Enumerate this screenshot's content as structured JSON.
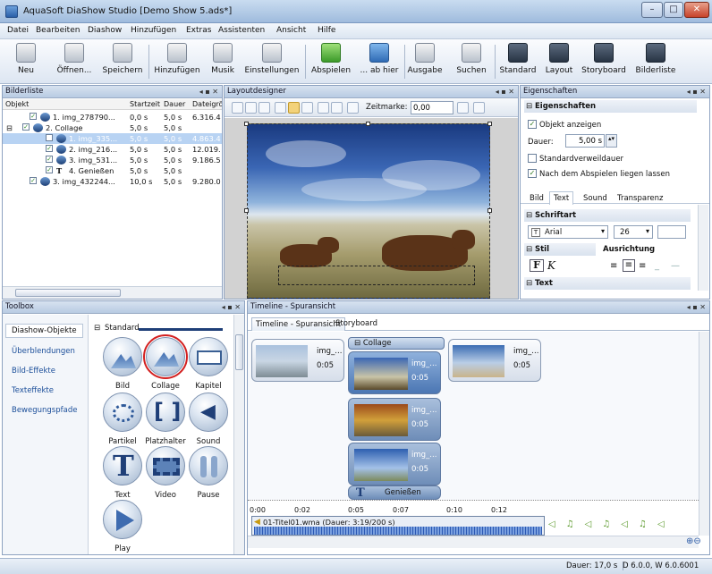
{
  "window": {
    "title": "AquaSoft DiaShow Studio [Demo Show 5.ads*]"
  },
  "menu": [
    "Datei",
    "Bearbeiten",
    "Diashow",
    "Hinzufügen",
    "Extras",
    "Assistenten",
    "Ansicht",
    "Hilfe"
  ],
  "toolbar": {
    "neu": "Neu",
    "oeffnen": "Öffnen...",
    "speichern": "Speichern",
    "hinzufuegen": "Hinzufügen",
    "musik": "Musik",
    "einstellungen": "Einstellungen",
    "abspielen": "Abspielen",
    "abhier": "... ab hier",
    "ausgabe": "Ausgabe",
    "suchen": "Suchen",
    "standard": "Standard",
    "layout": "Layout",
    "storyboard": "Storyboard",
    "bilderliste": "Bilderliste"
  },
  "bilderliste": {
    "title": "Bilderliste",
    "cols": {
      "objekt": "Objekt",
      "startzeit": "Startzeit",
      "dauer": "Dauer",
      "datei": "Dateigrö"
    },
    "rows": [
      {
        "name": "1. img_278790...",
        "start": "0,0 s",
        "dauer": "5,0 s",
        "size": "6.316.4"
      },
      {
        "name": "2. Collage",
        "start": "5,0 s",
        "dauer": "5,0 s",
        "size": ""
      },
      {
        "name": "1. img_335...",
        "start": "5,0 s",
        "dauer": "5,0 s",
        "size": "4.863.4"
      },
      {
        "name": "2. img_216...",
        "start": "5,0 s",
        "dauer": "5,0 s",
        "size": "12.019."
      },
      {
        "name": "3. img_531...",
        "start": "5,0 s",
        "dauer": "5,0 s",
        "size": "9.186.5"
      },
      {
        "name": "4. Genießen",
        "start": "5,0 s",
        "dauer": "5,0 s",
        "size": ""
      },
      {
        "name": "3. img_432244...",
        "start": "10,0 s",
        "dauer": "5,0 s",
        "size": "9.280.0"
      }
    ]
  },
  "layoutdesigner": {
    "title": "Layoutdesigner",
    "zeitmarke_label": "Zeitmarke:",
    "zeitmarke_value": "0,00"
  },
  "eigenschaften": {
    "title": "Eigenschaften",
    "section": "Eigenschaften",
    "objekt_anzeigen": "Objekt anzeigen",
    "dauer_label": "Dauer:",
    "dauer_value": "5,00 s",
    "standardverweildauer": "Standardverweildauer",
    "liegen_lassen": "Nach dem Abspielen liegen lassen",
    "tabs": [
      "Bild",
      "Text",
      "Sound",
      "Transparenz"
    ],
    "schriftart": "Schriftart",
    "font": "Arial",
    "size": "26",
    "stil": "Stil",
    "ausrichtung": "Ausrichtung",
    "text": "Text"
  },
  "toolbox": {
    "title": "Toolbox",
    "categories": [
      "Diashow-Objekte",
      "Überblendungen",
      "Bild-Effekte",
      "Texteffekte",
      "Bewegungspfade"
    ],
    "group": "Standard",
    "tools": [
      "Bild",
      "Collage",
      "Kapitel",
      "Partikel",
      "Platzhalter",
      "Sound",
      "Text",
      "Video",
      "Pause",
      "Play"
    ]
  },
  "timeline": {
    "title": "Timeline - Spuransicht",
    "tabs": [
      "Timeline - Spuransicht",
      "Storyboard"
    ],
    "items": [
      {
        "name": "img_...",
        "dur": "0:05"
      },
      {
        "name": "img_...",
        "dur": "0:05"
      }
    ],
    "collage": {
      "label": "Collage",
      "items": [
        {
          "name": "img_...",
          "dur": "0:05"
        },
        {
          "name": "img_...",
          "dur": "0:05"
        },
        {
          "name": "img_...",
          "dur": "0:05"
        }
      ],
      "text": "Genießen"
    },
    "ticks": [
      "0:00",
      "0:02",
      "0:05",
      "0:07",
      "0:10",
      "0:12"
    ],
    "audio": "01-Titel01.wma (Dauer: 3:19/200 s)"
  },
  "status": {
    "dauer": "Dauer: 17,0 s",
    "version": "D 6.0.0, W 6.0.6001"
  }
}
